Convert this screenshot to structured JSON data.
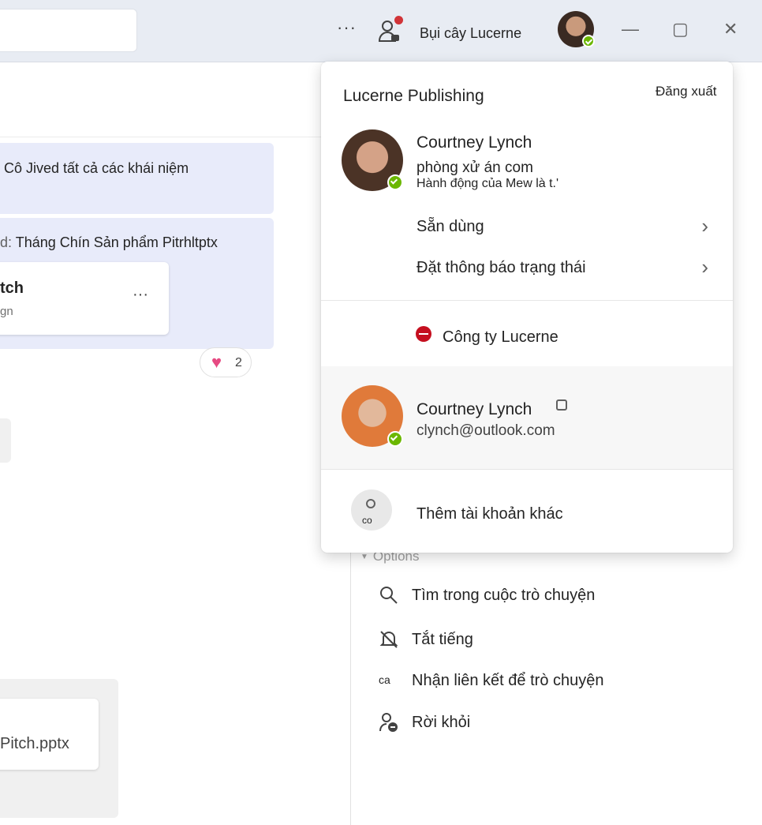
{
  "titlebar": {
    "more": "···",
    "user_name": "Bụi cây Lucerne",
    "minimize": "—",
    "maximize": "▢",
    "close": "✕"
  },
  "chat": {
    "message1": "Cô Jived tất cả các khái niệm",
    "message2_prefix": "d:",
    "message2": "Tháng Chín Sản phẩm Pitrhltptx",
    "file_title": "tch",
    "file_subtitle": "gn",
    "file_more": "···",
    "reaction_count": "2",
    "file2_name": "Pitch.pptx"
  },
  "options": {
    "header": "Options",
    "items": [
      {
        "label": "Tìm trong cuộc trò chuyện",
        "icon": "search-icon"
      },
      {
        "label": "Tắt tiếng",
        "icon": "bell-off-icon"
      },
      {
        "label": "Nhận liên kết để trò chuyện",
        "icon_text": "ca"
      },
      {
        "label": "Rời khỏi",
        "icon": "person-leave-icon"
      }
    ]
  },
  "popup": {
    "org_name": "Lucerne Publishing",
    "sign_out": "Đăng xuất",
    "profile": {
      "name": "Courtney Lynch",
      "email": "phòng xử án com",
      "status_message": "Hành động của Mew là t.'"
    },
    "menu": [
      {
        "label": "Sẵn dùng"
      },
      {
        "label": "Đặt thông báo trạng thái"
      }
    ],
    "org_status": "Công ty Lucerne",
    "other_account": {
      "name": "Courtney Lynch",
      "email": "clynch@outlook.com"
    },
    "add_account": {
      "icon_text": "co",
      "label": "Thêm tài khoản khác"
    }
  },
  "colors": {
    "titlebar_bg": "#e8ecf3",
    "message_bg": "#e8ebfa",
    "presence_available": "#6bb700",
    "dnd_red": "#c50f1f",
    "notification_dot": "#d13438"
  }
}
